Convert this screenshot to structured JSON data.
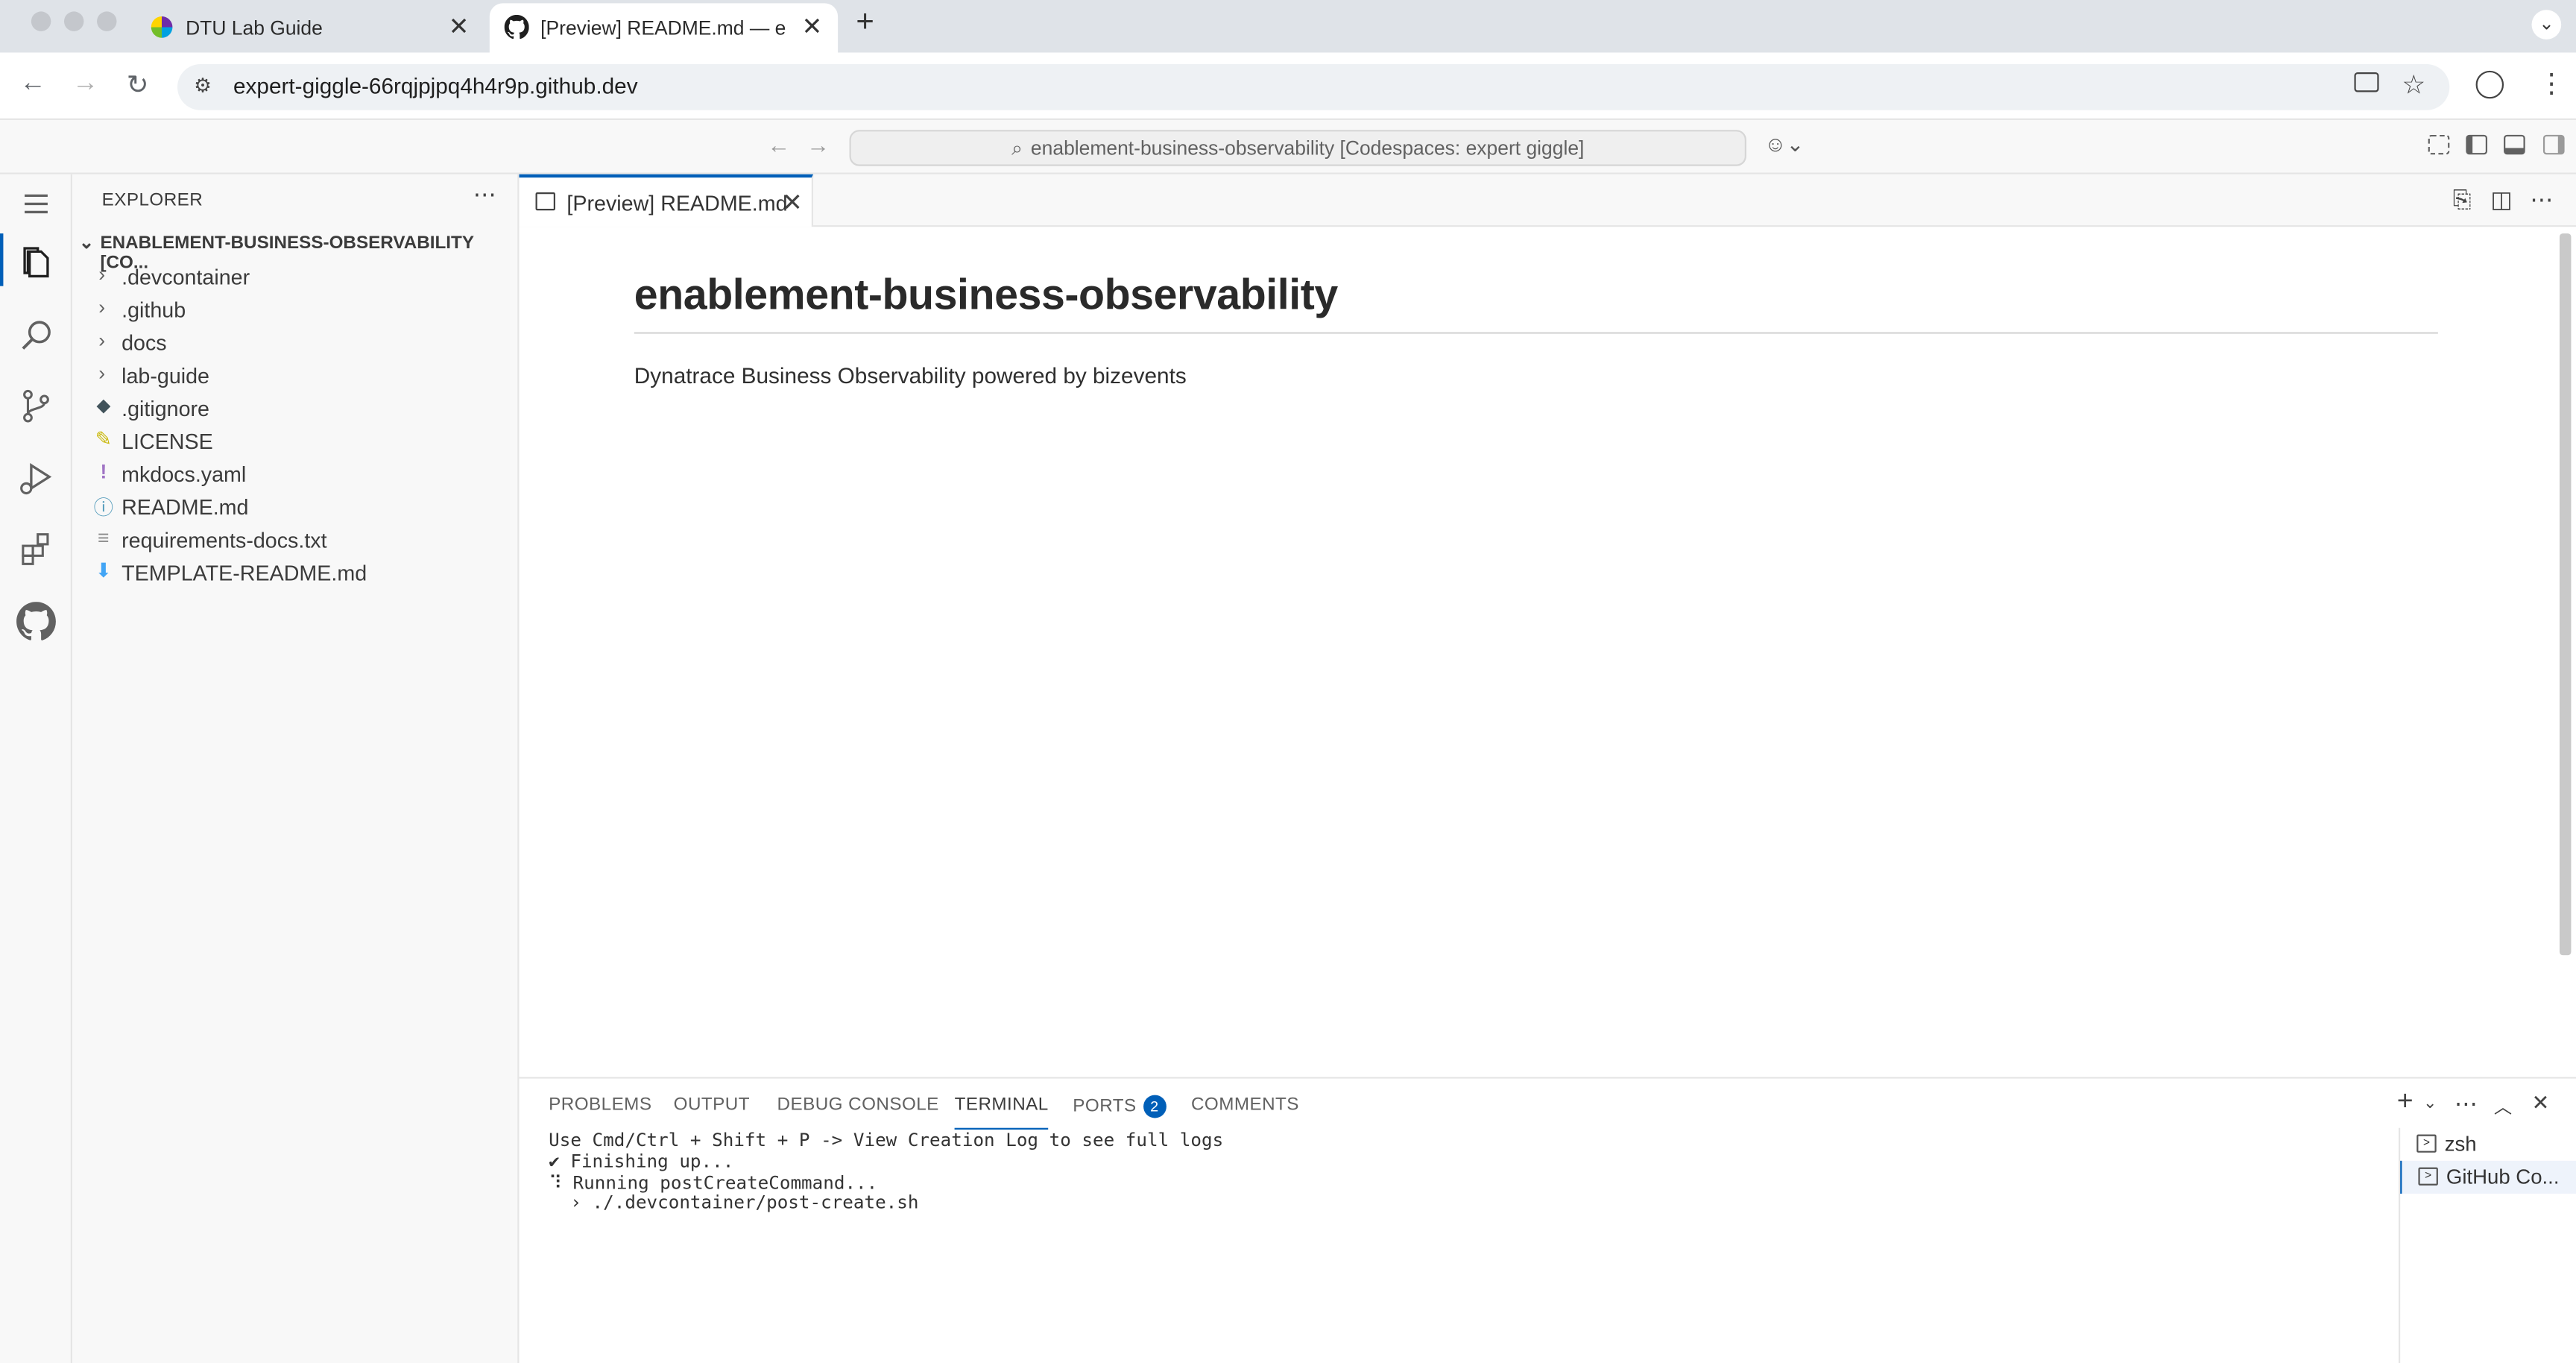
{
  "browser": {
    "tabs": [
      {
        "title": "DTU Lab Guide"
      },
      {
        "title": "[Preview] README.md — ena"
      }
    ],
    "new_tab": "+",
    "url": "expert-giggle-66rqjpjpq4h4r9p.github.dev"
  },
  "vscode": {
    "command_center": "enablement-business-observability [Codespaces: expert giggle]",
    "explorer": {
      "title": "EXPLORER",
      "root": "ENABLEMENT-BUSINESS-OBSERVABILITY [CO...",
      "items": [
        {
          "label": ".devcontainer",
          "type": "folder"
        },
        {
          "label": ".github",
          "type": "folder"
        },
        {
          "label": "docs",
          "type": "folder"
        },
        {
          "label": "lab-guide",
          "type": "folder"
        },
        {
          "label": ".gitignore",
          "type": "file",
          "icon": "git-icon"
        },
        {
          "label": "LICENSE",
          "type": "file",
          "icon": "license-icon"
        },
        {
          "label": "mkdocs.yaml",
          "type": "file",
          "icon": "yaml-icon"
        },
        {
          "label": "README.md",
          "type": "file",
          "icon": "info-icon"
        },
        {
          "label": "requirements-docs.txt",
          "type": "file",
          "icon": "text-file-icon"
        },
        {
          "label": "TEMPLATE-README.md",
          "type": "file",
          "icon": "markdown-icon"
        }
      ]
    },
    "editor_tab": "[Preview] README.md",
    "preview": {
      "heading": "enablement-business-observability",
      "paragraph": "Dynatrace Business Observability powered by bizevents"
    },
    "panel": {
      "tabs": [
        {
          "label": "PROBLEMS"
        },
        {
          "label": "OUTPUT"
        },
        {
          "label": "DEBUG CONSOLE"
        },
        {
          "label": "TERMINAL",
          "active": true
        },
        {
          "label": "PORTS",
          "badge": "2"
        },
        {
          "label": "COMMENTS"
        }
      ],
      "terminal_lines": [
        "Use Cmd/Ctrl + Shift + P -> View Creation Log to see full logs",
        "✔ Finishing up...",
        "⠹ Running postCreateCommand...",
        "  › ./.devcontainer/post-create.sh"
      ],
      "terminals": [
        {
          "label": "zsh"
        },
        {
          "label": "GitHub Co...",
          "selected": true
        }
      ]
    }
  },
  "colors": {
    "accent": "#005fb8",
    "tabstrip": "#dfe3e8",
    "sidebar_bg": "#f8f8f8"
  }
}
